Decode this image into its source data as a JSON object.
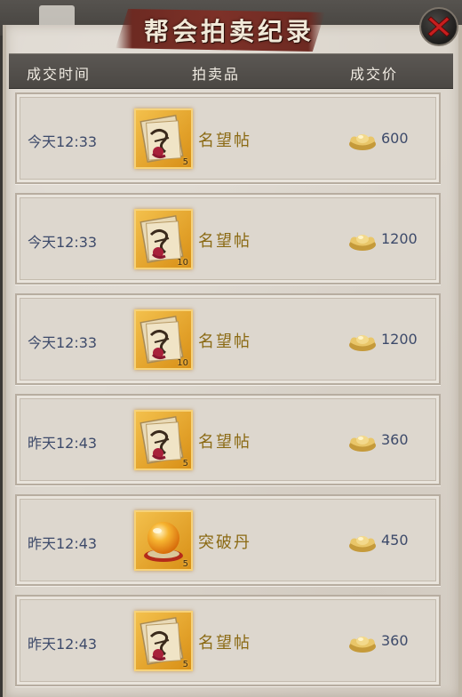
{
  "window": {
    "title": "帮会拍卖纪录",
    "close_icon": "close-icon"
  },
  "columns": {
    "time": "成交时间",
    "item": "拍卖品",
    "price": "成交价"
  },
  "records": [
    {
      "time": "今天12:33",
      "item": "名望帖",
      "icon": "scroll-icon",
      "qty": "5",
      "price": "600"
    },
    {
      "time": "今天12:33",
      "item": "名望帖",
      "icon": "scroll-icon",
      "qty": "10",
      "price": "1200"
    },
    {
      "time": "今天12:33",
      "item": "名望帖",
      "icon": "scroll-icon",
      "qty": "10",
      "price": "1200"
    },
    {
      "time": "昨天12:43",
      "item": "名望帖",
      "icon": "scroll-icon",
      "qty": "5",
      "price": "360"
    },
    {
      "time": "昨天12:43",
      "item": "突破丹",
      "icon": "pill-icon",
      "qty": "5",
      "price": "450"
    },
    {
      "time": "昨天12:43",
      "item": "名望帖",
      "icon": "scroll-icon",
      "qty": "5",
      "price": "360"
    }
  ],
  "colors": {
    "title_banner": "#7d3128",
    "item_name": "#8b6a14",
    "time_text": "#3d4a6a",
    "icon_frame": "#f3c04c"
  }
}
